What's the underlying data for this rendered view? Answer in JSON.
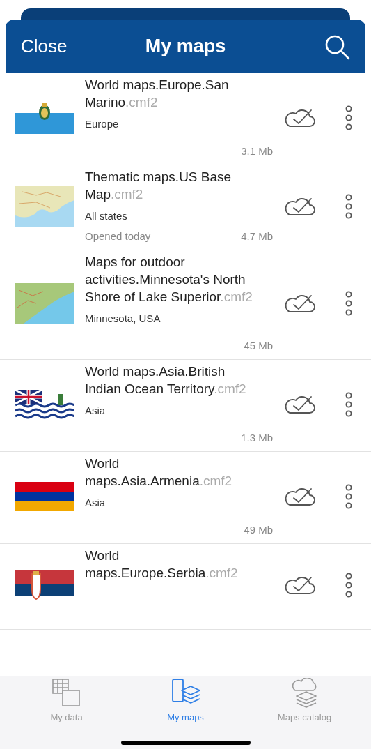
{
  "header": {
    "close": "Close",
    "title": "My maps"
  },
  "maps": [
    {
      "name": "World maps.Europe.San Marino",
      "extension": ".cmf2",
      "region": "Europe",
      "size": "3.1 Mb",
      "synced": true
    },
    {
      "name": "Thematic maps.US Base Map",
      "extension": ".cmf2",
      "region": "All states",
      "opened": "Opened today",
      "size": "4.7 Mb",
      "synced": true
    },
    {
      "name": "Maps for outdoor activities.Minnesota's North Shore of Lake Superior",
      "extension": ".cmf2",
      "region": "Minnesota, USA",
      "size": "45 Mb",
      "synced": true
    },
    {
      "name": "World maps.Asia.British Indian Ocean Territory",
      "extension": ".cmf2",
      "region": "Asia",
      "size": "1.3 Mb",
      "synced": true
    },
    {
      "name": "World maps.Asia.Armenia",
      "extension": ".cmf2",
      "region": "Asia",
      "size": "49 Mb",
      "synced": true
    },
    {
      "name": "World maps.Europe.Serbia",
      "extension": ".cmf2",
      "synced": true
    }
  ],
  "tabs": [
    {
      "label": "My data",
      "kind": "data",
      "selected": false
    },
    {
      "label": "My maps",
      "kind": "maps",
      "selected": true
    },
    {
      "label": "Maps catalog",
      "kind": "catalog",
      "selected": false
    }
  ]
}
